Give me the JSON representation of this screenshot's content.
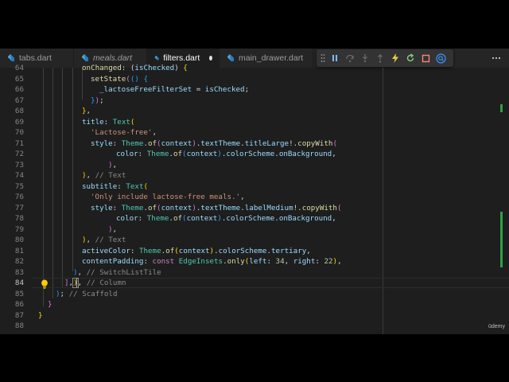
{
  "tabs": [
    {
      "label": "tabs.dart",
      "italic": false,
      "active": false
    },
    {
      "label": "meals.dart",
      "italic": true,
      "active": false
    },
    {
      "label": "filters.dart",
      "italic": false,
      "active": true,
      "unsaved": true
    },
    {
      "label": "main_drawer.dart",
      "italic": false,
      "active": false
    }
  ],
  "debug_toolbar": [
    "drag-grip-icon",
    "pause-icon",
    "step-over-icon",
    "step-into-icon",
    "step-out-icon",
    "hot-reload-icon",
    "restart-icon",
    "stop-icon",
    "devtools-search-icon"
  ],
  "colors": {
    "accent_green": "#2ea043",
    "hot_reload": "#e8c84a",
    "restart": "#89d185",
    "stop": "#f48771",
    "devtools": "#3794ff"
  },
  "lines": [
    {
      "n": "64",
      "text": "onChanged: (isChecked) {"
    },
    {
      "n": "65",
      "text": "setState(() {"
    },
    {
      "n": "66",
      "text": "_lactoseFreeFilterSet = isChecked;"
    },
    {
      "n": "67",
      "text": "});"
    },
    {
      "n": "68",
      "text": "},"
    },
    {
      "n": "69",
      "text": "title: Text("
    },
    {
      "n": "70",
      "text": "'Lactose-free',"
    },
    {
      "n": "71",
      "text": "style: Theme.of(context).textTheme.titleLarge!.copyWith("
    },
    {
      "n": "72",
      "text": "color: Theme.of(context).colorScheme.onBackground,"
    },
    {
      "n": "73",
      "text": "),"
    },
    {
      "n": "74",
      "text": "), // Text"
    },
    {
      "n": "75",
      "text": "subtitle: Text("
    },
    {
      "n": "76",
      "text": "'Only include lactose-free meals.',"
    },
    {
      "n": "77",
      "text": "style: Theme.of(context).textTheme.labelMedium!.copyWith("
    },
    {
      "n": "78",
      "text": "color: Theme.of(context).colorScheme.onBackground,"
    },
    {
      "n": "79",
      "text": "),"
    },
    {
      "n": "80",
      "text": "), // Text"
    },
    {
      "n": "81",
      "text": "activeColor: Theme.of(context).colorScheme.tertiary,"
    },
    {
      "n": "82",
      "text": "contentPadding: const EdgeInsets.only(left: 34, right: 22),"
    },
    {
      "n": "83",
      "text": "), // SwitchListTile"
    },
    {
      "n": "84",
      "text": "],), // Column"
    },
    {
      "n": "85",
      "text": "); // Scaffold"
    },
    {
      "n": "86",
      "text": "}"
    },
    {
      "n": "87",
      "text": "}"
    },
    {
      "n": "88",
      "text": ""
    }
  ],
  "watermark": "ūdemy"
}
